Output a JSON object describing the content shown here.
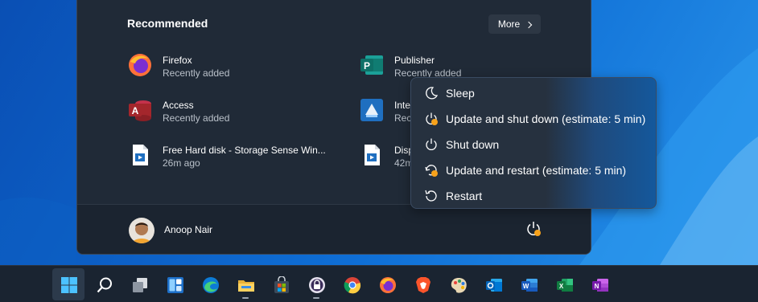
{
  "start_menu": {
    "recommended_title": "Recommended",
    "more_label": "More",
    "items": [
      {
        "name": "Firefox",
        "sub": "Recently added",
        "icon": "firefox-icon"
      },
      {
        "name": "Publisher",
        "sub": "Recently added",
        "icon": "publisher-icon"
      },
      {
        "name": "Access",
        "sub": "Recently added",
        "icon": "access-icon"
      },
      {
        "name": "Inte",
        "sub": "Rec",
        "icon": "app-icon"
      },
      {
        "name": "Free Hard disk - Storage Sense Win...",
        "sub": "26m ago",
        "icon": "video-file-icon"
      },
      {
        "name": "Disp",
        "sub": "42m",
        "icon": "video-file-icon"
      }
    ],
    "user_name": "Anoop Nair"
  },
  "power_menu": {
    "items": [
      {
        "label": "Sleep",
        "icon": "sleep-icon"
      },
      {
        "label": "Update and shut down (estimate: 5 min)",
        "icon": "update-shutdown-icon"
      },
      {
        "label": "Shut down",
        "icon": "power-icon"
      },
      {
        "label": "Update and restart (estimate: 5 min)",
        "icon": "update-restart-icon"
      },
      {
        "label": "Restart",
        "icon": "restart-icon"
      }
    ]
  },
  "taskbar": {
    "icons": [
      "start-icon",
      "search-icon",
      "task-view-icon",
      "widgets-icon",
      "edge-icon",
      "file-explorer-icon",
      "store-icon",
      "vpn-lock-icon",
      "chrome-icon",
      "firefox-icon",
      "brave-icon",
      "paint-icon",
      "outlook-icon",
      "word-icon",
      "excel-icon",
      "onenote-icon"
    ]
  },
  "colors": {
    "menu_bg": "#202a37",
    "accent_orange": "#f7a21b",
    "taskbar_bg": "#1a2431"
  }
}
